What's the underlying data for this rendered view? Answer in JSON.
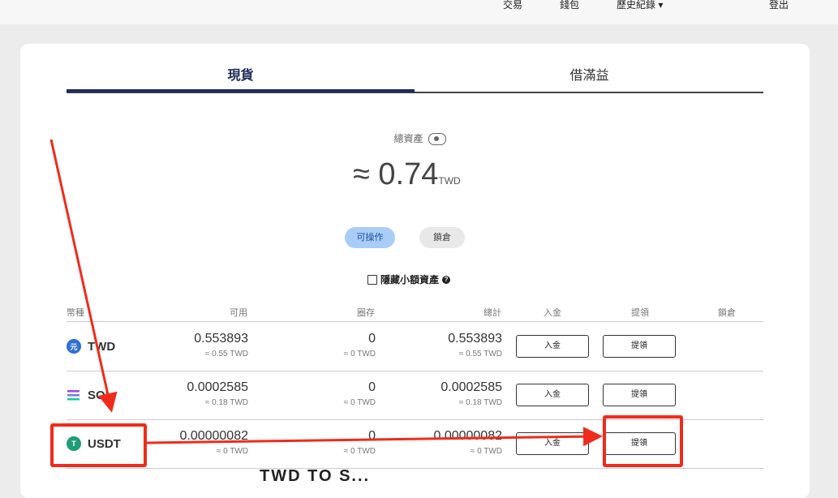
{
  "nav": {
    "items": [
      "交易",
      "錢包",
      "歷史紀錄 ▾",
      "登出"
    ]
  },
  "tabs": [
    "現貨",
    "借滿益"
  ],
  "total": {
    "label": "總資產",
    "value": "≈ 0.74",
    "currency": "TWD"
  },
  "filters": {
    "available": "可操作",
    "locked": "鎖倉"
  },
  "hide_small": {
    "label": "隱藏小額資產",
    "help": "?"
  },
  "table": {
    "headers": [
      "幣種",
      "可用",
      "圈存",
      "總計",
      "入金",
      "提領",
      "鎖倉"
    ],
    "rows": [
      {
        "coin": "TWD",
        "icon_text": "元",
        "available": "0.553893",
        "available_sub": "≈ 0.55 TWD",
        "held": "0",
        "held_sub": "≈ 0 TWD",
        "total": "0.553893",
        "total_sub": "≈ 0.55 TWD",
        "deposit": "入金",
        "withdraw": "提領"
      },
      {
        "coin": "SOL",
        "icon_text": "",
        "available": "0.0002585",
        "available_sub": "≈ 0.18 TWD",
        "held": "0",
        "held_sub": "≈ 0 TWD",
        "total": "0.0002585",
        "total_sub": "≈ 0.18 TWD",
        "deposit": "入金",
        "withdraw": "提領"
      },
      {
        "coin": "USDT",
        "icon_text": "T",
        "available": "0.00000082",
        "available_sub": "≈ 0 TWD",
        "held": "0",
        "held_sub": "≈ 0 TWD",
        "total": "0.00000082",
        "total_sub": "≈ 0 TWD",
        "deposit": "入金",
        "withdraw": "提領"
      }
    ]
  },
  "colors": {
    "accent": "#1e2d57",
    "highlight": "#f12b1c",
    "pill_active": "#a9cdf7"
  },
  "cutoff_text": "TWD  TO S..."
}
